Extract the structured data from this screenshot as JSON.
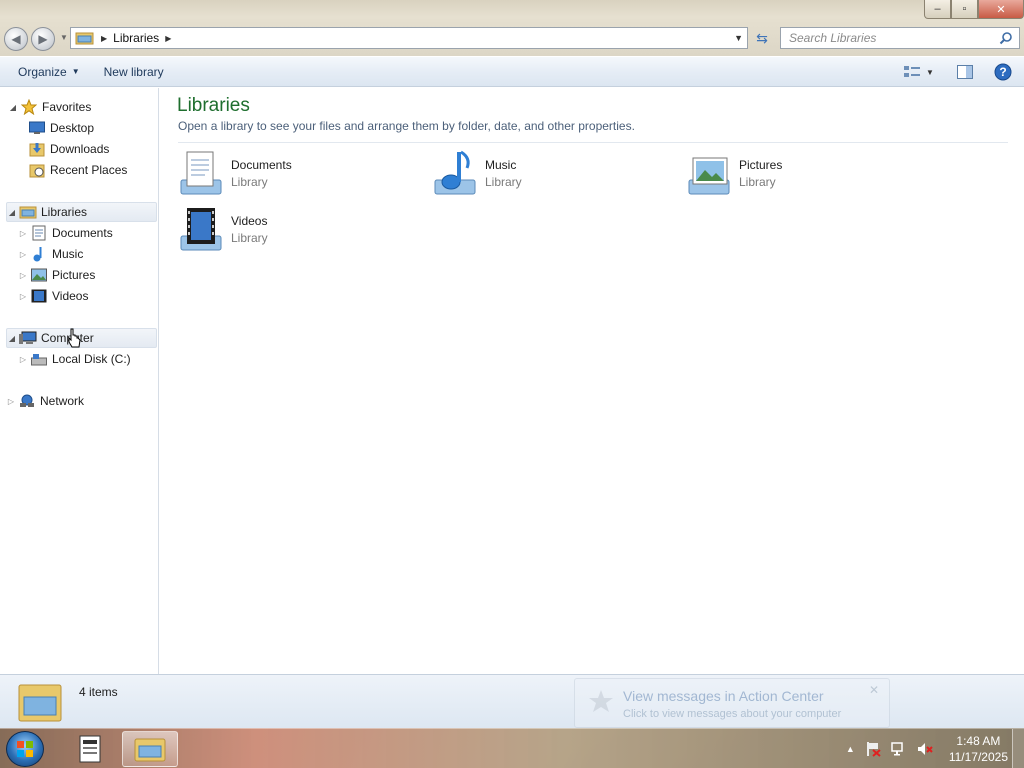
{
  "window": {
    "breadcrumb": [
      "Libraries"
    ],
    "search_placeholder": "Search Libraries",
    "controls": {
      "minimize": "–",
      "maximize": "▫",
      "close": "✕"
    }
  },
  "toolbar": {
    "organize_label": "Organize",
    "new_library_label": "New library"
  },
  "nav": {
    "favorites_label": "Favorites",
    "favorites_items": [
      {
        "label": "Desktop",
        "icon": "desktop-icon"
      },
      {
        "label": "Downloads",
        "icon": "downloads-icon"
      },
      {
        "label": "Recent Places",
        "icon": "recent-places-icon"
      }
    ],
    "libraries_label": "Libraries",
    "libraries_items": [
      {
        "label": "Documents",
        "icon": "documents-icon"
      },
      {
        "label": "Music",
        "icon": "music-icon"
      },
      {
        "label": "Pictures",
        "icon": "pictures-icon"
      },
      {
        "label": "Videos",
        "icon": "videos-icon"
      }
    ],
    "computer_label": "Computer",
    "computer_items": [
      {
        "label": "Local Disk (C:)",
        "icon": "local-disk-icon"
      }
    ],
    "network_label": "Network"
  },
  "main": {
    "title": "Libraries",
    "description": "Open a library to see your files and arrange them by folder, date, and other properties.",
    "tiles": [
      {
        "name": "Documents",
        "type": "Library"
      },
      {
        "name": "Music",
        "type": "Library"
      },
      {
        "name": "Pictures",
        "type": "Library"
      },
      {
        "name": "Videos",
        "type": "Library"
      }
    ]
  },
  "details": {
    "count_text": "4 items"
  },
  "notification": {
    "title": "View messages in Action Center",
    "subtitle": "Click to view messages about your computer"
  },
  "taskbar": {
    "time": "1:48 AM",
    "date": "11/17/2025"
  },
  "colors": {
    "heading_green": "#1e6e2e",
    "toolbar_text": "#1e395b"
  }
}
